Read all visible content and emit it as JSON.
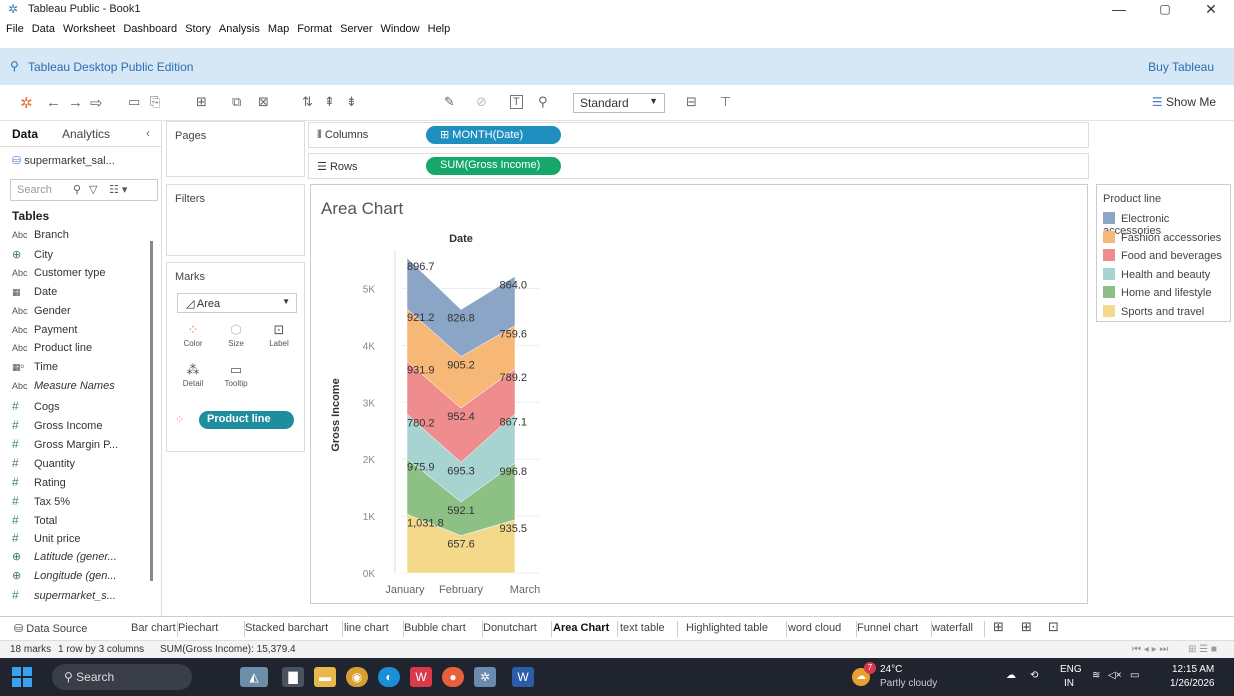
{
  "window": {
    "title": "Tableau Public - Book1",
    "minimize": "—",
    "maximize": "▢",
    "close": "✕"
  },
  "menu": [
    "File",
    "Data",
    "Worksheet",
    "Dashboard",
    "Story",
    "Analysis",
    "Map",
    "Format",
    "Server",
    "Window",
    "Help"
  ],
  "edition": {
    "label": "Tableau Desktop Public Edition",
    "buy": "Buy Tableau"
  },
  "toolbar": {
    "mark_size": "Standard",
    "show_me": "Show Me"
  },
  "data_pane": {
    "tab_data": "Data",
    "tab_analytics": "Analytics",
    "datasource": "supermarket_sal...",
    "search_placeholder": "Search",
    "tables_heading": "Tables",
    "fields": [
      {
        "type": "Abc",
        "name": "Branch"
      },
      {
        "type": "geo",
        "name": "City"
      },
      {
        "type": "Abc",
        "name": "Customer type"
      },
      {
        "type": "date",
        "name": "Date"
      },
      {
        "type": "Abc",
        "name": "Gender"
      },
      {
        "type": "Abc",
        "name": "Payment"
      },
      {
        "type": "Abc",
        "name": "Product line"
      },
      {
        "type": "datetime",
        "name": "Time"
      },
      {
        "type": "Abc",
        "name": "Measure Names",
        "italic": true
      },
      {
        "type": "#",
        "name": "Cogs"
      },
      {
        "type": "#",
        "name": "Gross Income"
      },
      {
        "type": "#",
        "name": "Gross Margin P..."
      },
      {
        "type": "#",
        "name": "Quantity"
      },
      {
        "type": "#",
        "name": "Rating"
      },
      {
        "type": "#",
        "name": "Tax 5%"
      },
      {
        "type": "#",
        "name": "Total"
      },
      {
        "type": "#",
        "name": "Unit price"
      },
      {
        "type": "geo",
        "name": "Latitude (gener...",
        "italic": true
      },
      {
        "type": "geo",
        "name": "Longitude (gen...",
        "italic": true
      },
      {
        "type": "#",
        "name": "supermarket_s...",
        "italic": true
      }
    ]
  },
  "cards": {
    "pages": "Pages",
    "filters": "Filters",
    "marks": "Marks",
    "mark_type": "Area",
    "mark_buttons": [
      "Color",
      "Size",
      "Label",
      "Detail",
      "Tooltip"
    ],
    "color_pill": "Product line"
  },
  "shelves": {
    "columns_label": "Columns",
    "columns_pill": "MONTH(Date)",
    "rows_label": "Rows",
    "rows_pill": "SUM(Gross Income)"
  },
  "legend": {
    "title": "Product line"
  },
  "colors": {
    "Electronic accessories": "#8aa5c6",
    "Fashion accessories": "#f7b777",
    "Food and beverages": "#ef8c8e",
    "Health and beauty": "#a7d3d1",
    "Home and lifestyle": "#8cc084",
    "Sports and travel": "#f4d98a"
  },
  "chart_data": {
    "type": "area",
    "title": "Area Chart",
    "column_header": "Date",
    "ylabel": "Gross Income",
    "categories": [
      "January",
      "February",
      "March"
    ],
    "yticks": [
      "0K",
      "1K",
      "2K",
      "3K",
      "4K",
      "5K"
    ],
    "ylim": [
      0,
      5500
    ],
    "stacked": true,
    "series": [
      {
        "name": "Sports and travel",
        "values": [
          1031.8,
          657.6,
          935.5
        ],
        "labels": [
          "1,031.8",
          "657.6",
          "935.5"
        ]
      },
      {
        "name": "Home and lifestyle",
        "values": [
          975.9,
          592.1,
          996.8
        ],
        "labels": [
          "975.9",
          "592.1",
          "996.8"
        ]
      },
      {
        "name": "Health and beauty",
        "values": [
          780.2,
          695.3,
          867.1
        ],
        "labels": [
          "780.2",
          "695.3",
          "867.1"
        ]
      },
      {
        "name": "Food and beverages",
        "values": [
          931.9,
          952.4,
          789.2
        ],
        "labels": [
          "931.9",
          "952.4",
          "789.2"
        ]
      },
      {
        "name": "Fashion accessories",
        "values": [
          921.2,
          905.2,
          759.6
        ],
        "labels": [
          "921.2",
          "905.2",
          "759.6"
        ]
      },
      {
        "name": "Electronic accessories",
        "values": [
          896.7,
          826.8,
          864.0
        ],
        "labels": [
          "896.7",
          "826.8",
          "864.0"
        ]
      }
    ]
  },
  "sheet_tabs": {
    "datasource": "Data Source",
    "tabs": [
      "Bar chart",
      "Piechart",
      "Stacked barchart",
      "line chart",
      "Bubble chart",
      "Donutchart",
      "Area Chart",
      "text table",
      "Highlighted table",
      "word cloud",
      "Funnel chart",
      "waterfall"
    ],
    "active": "Area Chart"
  },
  "status": {
    "marks": "18 marks",
    "shape": "1 row by 3 columns",
    "sum": "SUM(Gross Income): 15,379.4"
  },
  "taskbar": {
    "search": "Search",
    "temp": "24°C",
    "weather": "Partly cloudy",
    "weather_badge": "7",
    "lang": "ENG",
    "region": "IN",
    "time": "12:15 AM",
    "date": "1/26/2026"
  }
}
